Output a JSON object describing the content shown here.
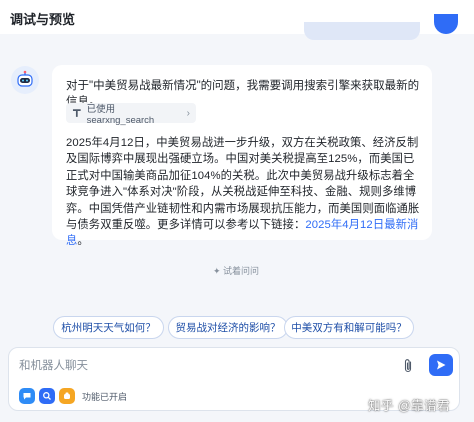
{
  "header": {
    "title": "调试与预览"
  },
  "message": {
    "intro": "对于\"中美贸易战最新情况\"的问题，我需要调用搜索引擎来获取最新的信息。",
    "tool_call": {
      "label": "已使用 searxng_search",
      "icon": "tool-icon"
    },
    "body": "2025年4月12日，中美贸易战进一步升级，双方在关税政策、经济反制及国际博弈中展现出强硬立场。中国对美关税提高至125%，而美国已正式对中国输美商品加征104%的关税。此次中美贸易战升级标志着全球竞争进入\"体系对决\"阶段，从关税战延伸至科技、金融、规则多维博弈。中国凭借产业链韧性和内需市场展现抗压能力，而美国则面临通胀与债务双重反噬。更多详情可以参考以下链接：",
    "link_text": "2025年4月12日最新消息",
    "link_suffix": "。"
  },
  "suggestions": {
    "label": "✦ 试着问问",
    "items": [
      "杭州明天天气如何？",
      "贸易战对经济的影响？",
      "中美双方有和解可能吗？"
    ]
  },
  "input": {
    "placeholder": "和机器人聊天",
    "function_status": "功能已开启"
  },
  "watermark": "知乎 @靠谱君",
  "colors": {
    "accent": "#2f6cf6",
    "background": "#f4f6fa",
    "card": "#ffffff"
  }
}
